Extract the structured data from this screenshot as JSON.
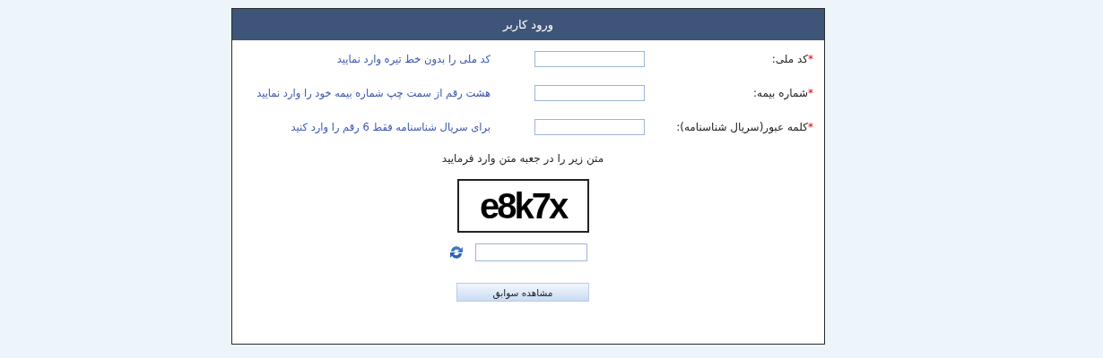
{
  "panel": {
    "title": "ورود کاربر"
  },
  "fields": [
    {
      "mark": "*",
      "label": "کد ملی:",
      "hint": "کد ملی را بدون خط تیره وارد نمایید"
    },
    {
      "mark": "*",
      "label": "شماره بیمه:",
      "hint": "هشت رقم از سمت چپ شماره بیمه خود را وارد نمایید"
    },
    {
      "mark": "*",
      "label": "کلمه عبور(سریال شناسنامه):",
      "hint": "برای سریال شناسنامه فقط 6 رقم را وارد کنید"
    }
  ],
  "captcha": {
    "instruction": "متن زیر را در جعبه متن وارد فرمایید",
    "code": "e8k7x"
  },
  "submit": "مشاهده سوابق"
}
